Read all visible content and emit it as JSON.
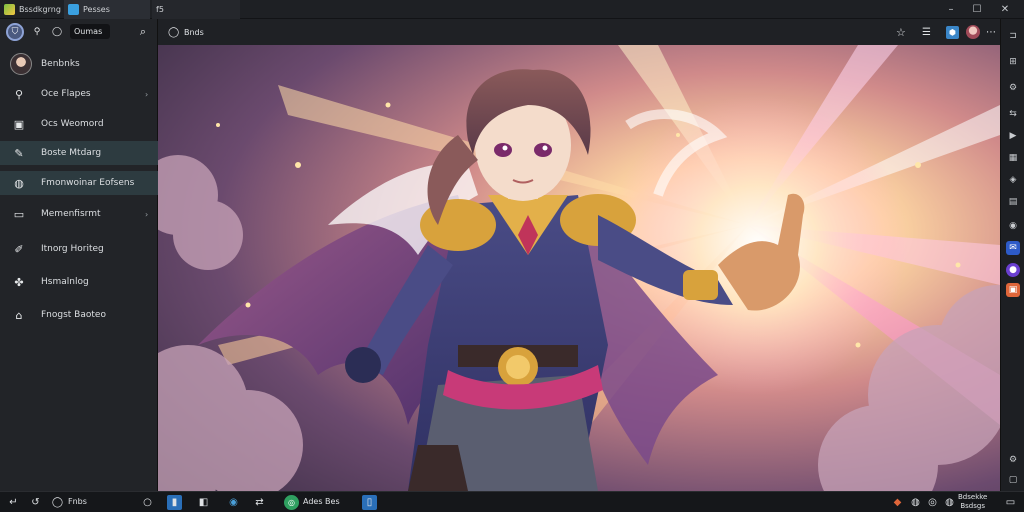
{
  "tabs": [
    {
      "label": "Bssdkgrng",
      "icon": "app-cube-icon"
    },
    {
      "label": "Pesses",
      "icon": "browser-tab-icon"
    },
    {
      "label": "f5",
      "icon": ""
    }
  ],
  "window_controls": {
    "minimize": "–",
    "maximize": "☐",
    "close": "✕"
  },
  "sidebar": {
    "search_value": "Oumas",
    "profile_label": "Benbnks",
    "items": [
      {
        "label": "Oce Flapes",
        "icon": "search-icon",
        "chevron": true
      },
      {
        "label": "Ocs Weomord",
        "icon": "bookmark-icon",
        "chevron": false
      },
      {
        "label": "Boste Mtdarg",
        "icon": "brush-icon",
        "chevron": false
      },
      {
        "label": "Fmonwoinar Eofsens",
        "icon": "globe-icon",
        "chevron": false
      },
      {
        "label": "Memenfisrmt",
        "icon": "window-icon",
        "chevron": true
      },
      {
        "label": "Itnorg Horiteg",
        "icon": "pen-icon",
        "chevron": false
      },
      {
        "label": "Hsmalnlog",
        "icon": "puzzle-icon",
        "chevron": false
      },
      {
        "label": "Fnogst Baoteo",
        "icon": "home-icon",
        "chevron": false
      }
    ]
  },
  "address": {
    "value": "Bnds"
  },
  "taskbar": {
    "search_label": "Fnbs",
    "pinned_label": "Ades Bes",
    "tray_line1": "Bdsekke",
    "tray_line2": "Bsdsgs"
  },
  "colors": {
    "accent": "#4a9fd8",
    "sidebar_bg": "#222428",
    "highlight": "#2d3b40"
  }
}
